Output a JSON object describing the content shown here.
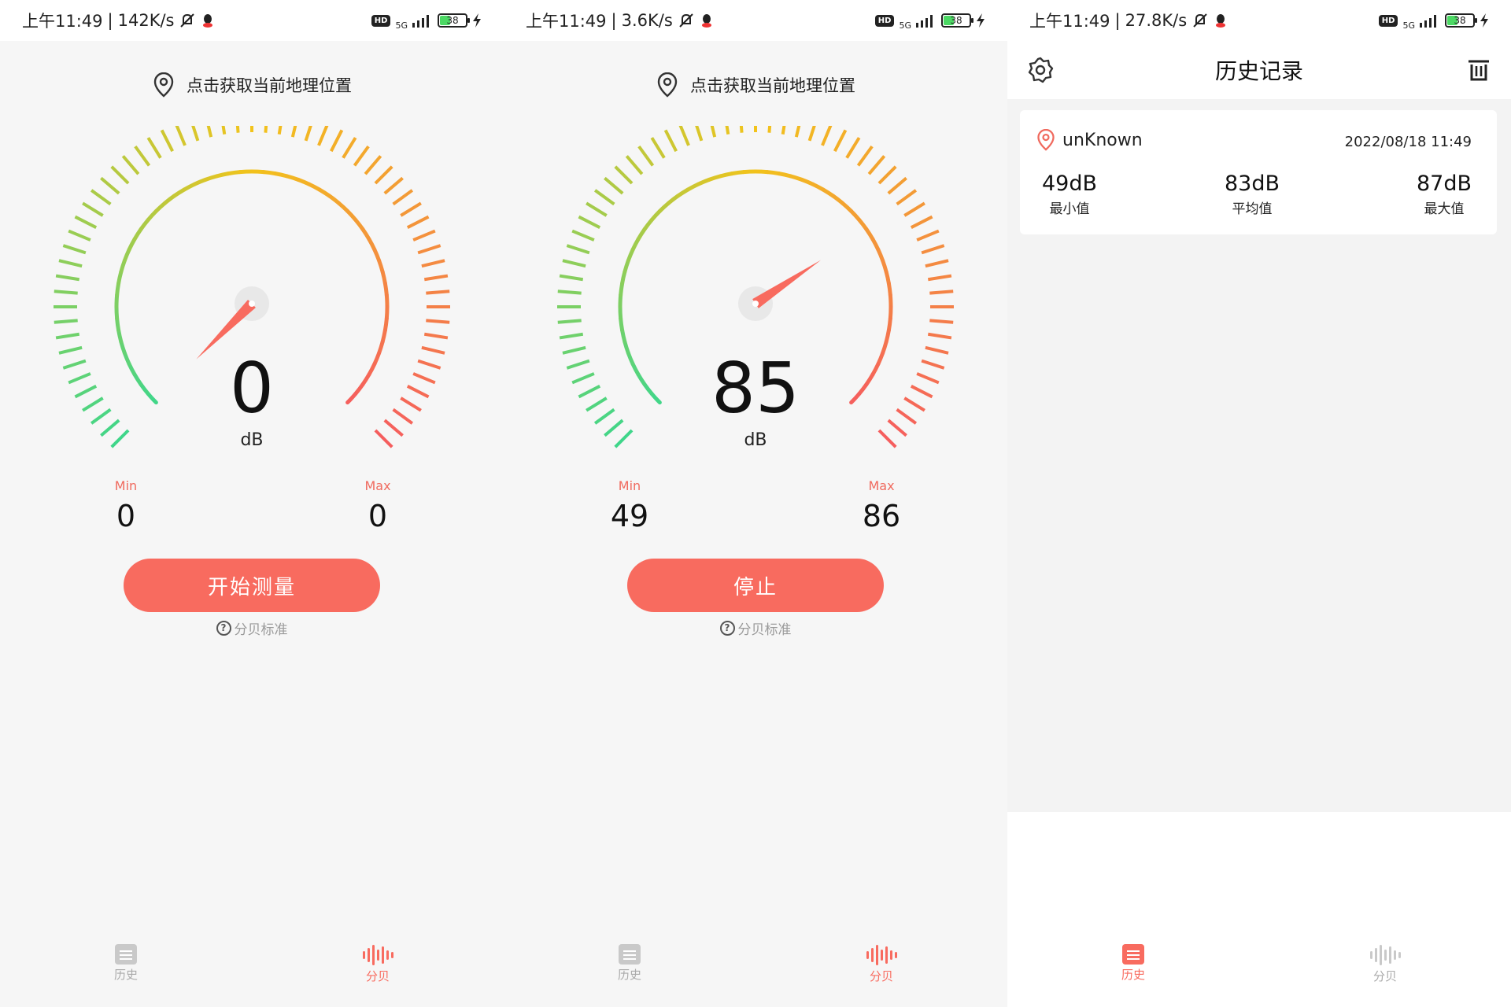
{
  "status_bars": [
    {
      "time": "上午11:49",
      "speed": "142K/s",
      "network": "5G",
      "battery": "38"
    },
    {
      "time": "上午11:49",
      "speed": "3.6K/s",
      "network": "5G",
      "battery": "38"
    },
    {
      "time": "上午11:49",
      "speed": "27.8K/s",
      "network": "5G",
      "battery": "38"
    }
  ],
  "hd_label": "HD",
  "separator": "|",
  "location_prompt": "点击获取当前地理位置",
  "unit": "dB",
  "min_label": "Min",
  "max_label": "Max",
  "help_icon": "?",
  "help_text": "分贝标准",
  "meter_idle": {
    "reading": "0",
    "needle_db": 0,
    "min": "0",
    "max": "0",
    "button": "开始测量"
  },
  "meter_active": {
    "reading": "85",
    "needle_db": 85,
    "min": "49",
    "max": "86",
    "button": "停止"
  },
  "gauge_scale": {
    "min_db": 0,
    "max_db": 120
  },
  "nav": {
    "history": "历史",
    "decibel": "分贝"
  },
  "history": {
    "title": "历史记录",
    "records": [
      {
        "location": "unKnown",
        "datetime": "2022/08/18 11:49",
        "min_value": "49dB",
        "min_label": "最小值",
        "avg_value": "83dB",
        "avg_label": "平均值",
        "max_value": "87dB",
        "max_label": "最大值"
      }
    ]
  },
  "colors": {
    "accent": "#f86b5f",
    "arc_start": "#3fd68a",
    "arc_mid": "#f2c31b",
    "arc_end": "#f55e5e"
  },
  "icons": [
    "location-pin-icon",
    "settings-gear-icon",
    "trash-icon",
    "help-icon",
    "history-list-icon",
    "sound-wave-icon",
    "mute-icon",
    "qq-icon",
    "signal-icon",
    "battery-icon",
    "charging-icon"
  ]
}
